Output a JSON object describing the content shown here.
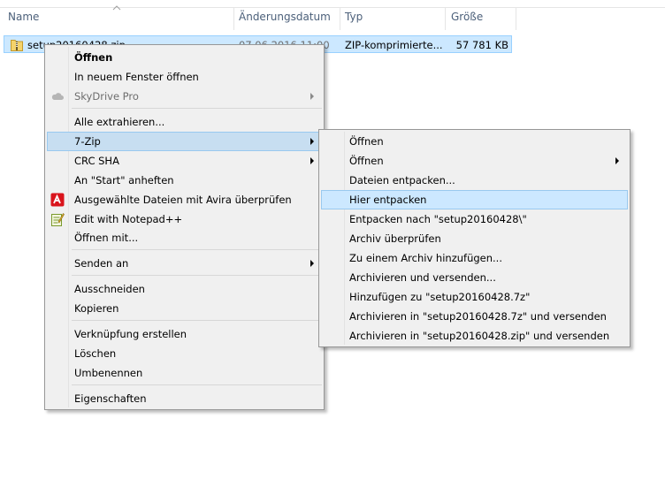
{
  "columns": {
    "name": "Name",
    "date": "Änderungsdatum",
    "type": "Typ",
    "size": "Größe"
  },
  "file": {
    "name": "setup20160428.zip",
    "date": "07.06.2016 11:00",
    "type": "ZIP-komprimierte...",
    "size": "57 781 KB",
    "icon": "zip-folder-icon"
  },
  "context_menu": {
    "open": "Öffnen",
    "open_new_window": "In neuem Fenster öffnen",
    "skydrive": "SkyDrive Pro",
    "extract_all": "Alle extrahieren...",
    "seven_zip": "7-Zip",
    "crc_sha": "CRC SHA",
    "pin_start": "An \"Start\" anheften",
    "avira_scan": "Ausgewählte Dateien mit Avira überprüfen",
    "edit_notepad": "Edit with Notepad++",
    "open_with": "Öffnen mit...",
    "send_to": "Senden an",
    "cut": "Ausschneiden",
    "copy": "Kopieren",
    "create_shortcut": "Verknüpfung erstellen",
    "delete": "Löschen",
    "rename": "Umbenennen",
    "properties": "Eigenschaften"
  },
  "zip_submenu": {
    "open": "Öffnen",
    "open_sub": "Öffnen",
    "extract_files": "Dateien entpacken...",
    "extract_here": "Hier entpacken",
    "extract_to": "Entpacken nach \"setup20160428\\\"",
    "test_archive": "Archiv überprüfen",
    "add_to_archive": "Zu einem Archiv hinzufügen...",
    "compress_email": "Archivieren und versenden...",
    "add_to_7z": "Hinzufügen zu \"setup20160428.7z\"",
    "compress_7z_email": "Archivieren in \"setup20160428.7z\" und versenden",
    "compress_zip_email": "Archivieren in \"setup20160428.zip\" und versenden"
  },
  "colors": {
    "selection": "#cce8ff",
    "menu_bg": "#f0f0f0",
    "header_text": "#4c607a"
  }
}
